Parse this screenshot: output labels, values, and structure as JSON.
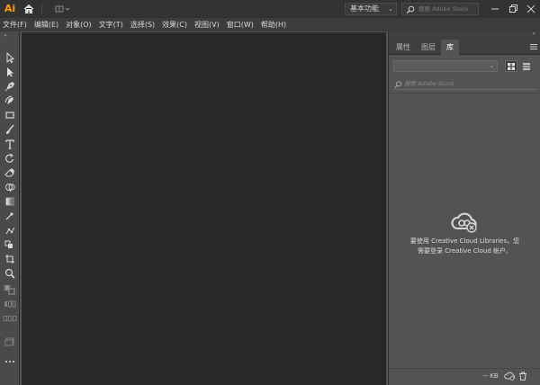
{
  "app": {
    "logo_text": "Ai",
    "logo_color": "#ff9a00"
  },
  "titlebar": {
    "workspace_label": "基本功能",
    "stock_search_placeholder": "搜索 Adobe Stock"
  },
  "menubar": {
    "items": [
      "文件(F)",
      "编辑(E)",
      "对象(O)",
      "文字(T)",
      "选择(S)",
      "效果(C)",
      "视图(V)",
      "窗口(W)",
      "帮助(H)"
    ]
  },
  "panel": {
    "tabs": [
      "属性",
      "图层",
      "库"
    ],
    "active_tab": "库",
    "library_search_placeholder": "搜索 Adobe Stock",
    "message_line1": "要使用 Creative Cloud Libraries，您",
    "message_line2": "需要登录 Creative Cloud 帐户。",
    "storage_label": "-- KB"
  },
  "toolbar": {
    "tools": [
      "selection-tool",
      "direct-selection-tool",
      "pen-tool",
      "curvature-tool",
      "rectangle-tool",
      "paintbrush-tool",
      "type-tool",
      "rotate-tool",
      "eraser-tool",
      "shape-builder-tool",
      "gradient-tool",
      "eyedropper-tool",
      "puppet-warp-tool",
      "blend-tool",
      "artboard-tool",
      "zoom-tool",
      "fill-stroke-swatch",
      "drawing-modes",
      "screen-mode",
      "edit-toolbar"
    ]
  },
  "colors": {
    "canvas": "#282828",
    "panel": "#535353",
    "titlebar": "#323232",
    "menubar": "#3c3c3c"
  }
}
